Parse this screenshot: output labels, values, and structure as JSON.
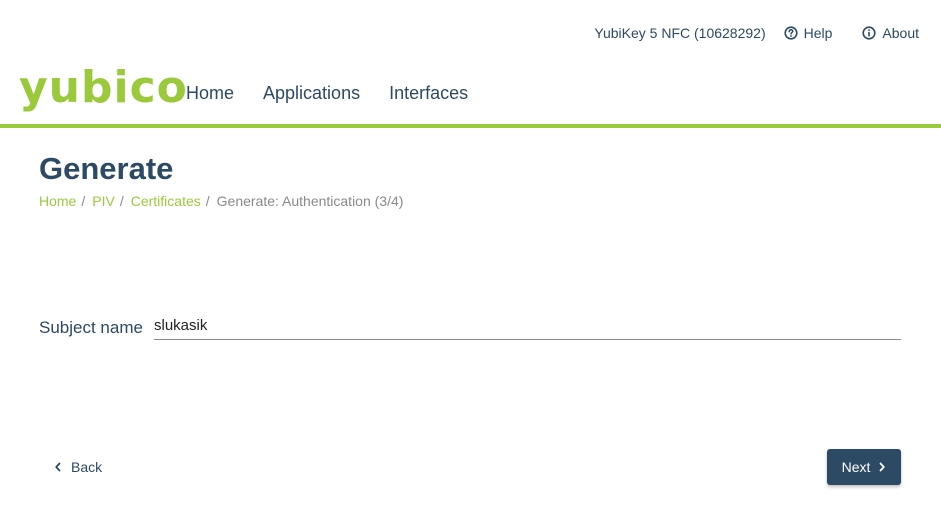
{
  "topbar": {
    "device_name": "YubiKey 5 NFC (10628292)",
    "help_label": "Help",
    "about_label": "About"
  },
  "logo": "yubico",
  "nav": {
    "items": [
      {
        "label": "Home"
      },
      {
        "label": "Applications"
      },
      {
        "label": "Interfaces"
      }
    ]
  },
  "page": {
    "title": "Generate"
  },
  "breadcrumb": {
    "items": [
      "Home",
      "PIV",
      "Certificates"
    ],
    "current": "Generate: Authentication (3/4)",
    "separator": "/"
  },
  "form": {
    "subject_label": "Subject name",
    "subject_value": "slukasik"
  },
  "actions": {
    "back_label": "Back",
    "next_label": "Next"
  },
  "colors": {
    "accent": "#9aca3c",
    "primary": "#2c4a63",
    "muted": "#8a8a8a"
  },
  "icons": {
    "help": "help-circle-icon",
    "about": "info-circle-icon",
    "back": "chevron-left-icon",
    "next": "chevron-right-icon"
  }
}
